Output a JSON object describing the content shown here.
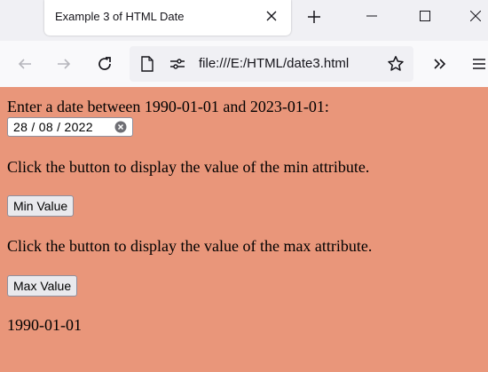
{
  "tab": {
    "title": "Example 3 of HTML Date"
  },
  "navbar": {
    "url": "file:///E:/HTML/date3.html"
  },
  "content": {
    "prompt": "Enter a date between 1990-01-01 and 2023-01-01:",
    "date_input_value": "28 / 08 / 2022",
    "min_instruction": "Click the button to display the value of the min attribute.",
    "min_button_label": "Min Value",
    "max_instruction": "Click the button to display the value of the max attribute.",
    "max_button_label": "Max Value",
    "output": "1990-01-01"
  },
  "colors": {
    "page_background": "#e9967a",
    "button_background": "#e9e9ed",
    "chrome_background": "#f0f0f4"
  },
  "icons": [
    "close-icon",
    "plus-icon",
    "minimize-icon",
    "maximize-icon",
    "window-close-icon",
    "back-arrow-icon",
    "forward-arrow-icon",
    "reload-icon",
    "page-icon",
    "permissions-icon",
    "star-icon",
    "overflow-chevrons-icon",
    "hamburger-menu-icon",
    "clear-circle-icon"
  ]
}
